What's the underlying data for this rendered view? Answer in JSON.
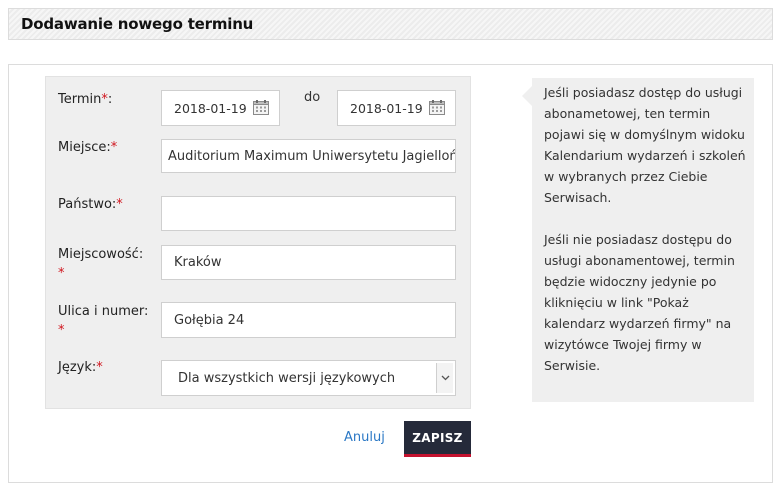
{
  "page": {
    "title": "Dodawanie nowego terminu"
  },
  "form": {
    "term": {
      "label": "Termin",
      "required_mark": "*",
      "suffix": ":",
      "from_value": "2018-01-19",
      "to_label": "do",
      "to_value": "2018-01-19"
    },
    "place": {
      "label": "Miejsce:",
      "required_mark": "*",
      "value": "Auditorium Maximum Uniwersytetu Jagiellońskiego"
    },
    "country": {
      "label": "Państwo:",
      "required_mark": "*",
      "value": ""
    },
    "city": {
      "label": "Miejscowość:",
      "required_mark": "*",
      "value": "Kraków"
    },
    "street": {
      "label": "Ulica i numer:",
      "required_mark": "*",
      "value": "Gołębia 24"
    },
    "language": {
      "label": "Język:",
      "required_mark": "*",
      "selected": "Dla wszystkich wersji językowych"
    }
  },
  "actions": {
    "cancel_label": "Anuluj",
    "save_label": "ZAPISZ"
  },
  "info": {
    "paragraph1": "Jeśli posiadasz dostęp do usługi abonametowej, ten termin pojawi się w domyślnym widoku Kalendarium wydarzeń i szkoleń w wybranych przez Ciebie Serwisach.",
    "paragraph2": "Jeśli nie posiadasz dostępu do usługi abonamentowej, termin będzie widoczny jedynie po kliknięciu w link \"Pokaż kalendarz wydarzeń firmy\" na wizytówce Twojej firmy w Serwisie."
  },
  "colors": {
    "required": "#d0141d",
    "save_bg": "#252a3a",
    "save_accent": "#c4122f",
    "link": "#2b78c5",
    "panel_bg": "#efefef"
  }
}
